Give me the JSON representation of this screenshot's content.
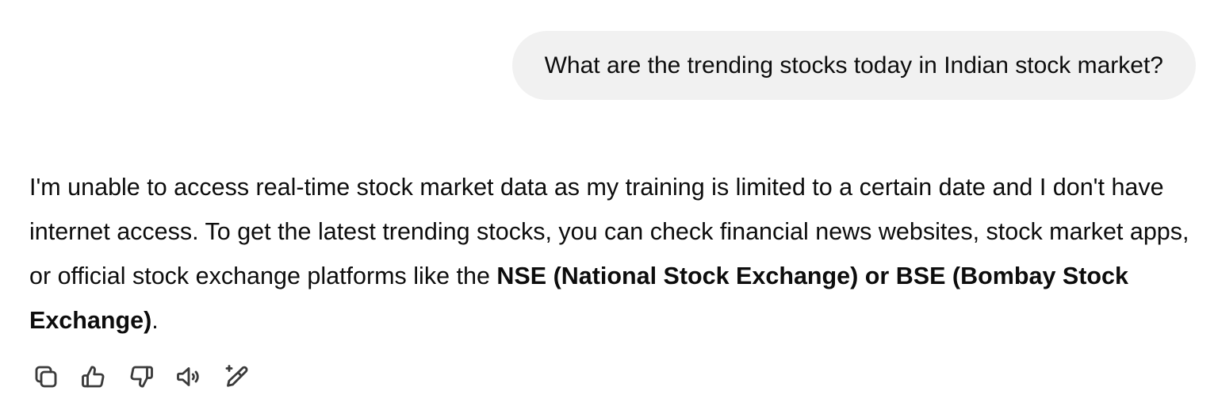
{
  "user_message": {
    "text": "What are the trending stocks today in Indian stock market?"
  },
  "assistant_message": {
    "text_plain": "I'm unable to access real-time stock market data as my training is limited to a certain date and I don't have internet access. To get the latest trending stocks, you can check financial news websites, stock market apps, or official stock exchange platforms like the ",
    "text_bold": "NSE (National Stock Exchange) or BSE (Bombay Stock Exchange)",
    "text_end": "."
  },
  "actions": [
    {
      "name": "copy-icon"
    },
    {
      "name": "thumbs-up-icon"
    },
    {
      "name": "thumbs-down-icon"
    },
    {
      "name": "read-aloud-icon"
    },
    {
      "name": "edit-sparkle-icon"
    }
  ],
  "colors": {
    "user_bubble_bg": "#f1f1f1",
    "text": "#0d0d0d",
    "icon": "#3b3b3b"
  }
}
